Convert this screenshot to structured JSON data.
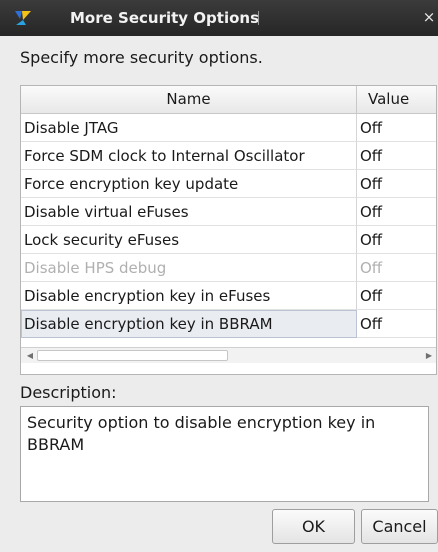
{
  "window": {
    "title": "More Security Options",
    "close_glyph": "×",
    "icon": "quartus-app-icon"
  },
  "instruction": "Specify more security options.",
  "table": {
    "columns": [
      "Name",
      "Value"
    ],
    "rows": [
      {
        "name": "Disable JTAG",
        "value": "Off",
        "enabled": true,
        "selected": false
      },
      {
        "name": "Force SDM clock to Internal Oscillator",
        "value": "Off",
        "enabled": true,
        "selected": false
      },
      {
        "name": "Force encryption key update",
        "value": "Off",
        "enabled": true,
        "selected": false
      },
      {
        "name": "Disable virtual eFuses",
        "value": "Off",
        "enabled": true,
        "selected": false
      },
      {
        "name": "Lock security eFuses",
        "value": "Off",
        "enabled": true,
        "selected": false
      },
      {
        "name": "Disable HPS debug",
        "value": "Off",
        "enabled": false,
        "selected": false
      },
      {
        "name": "Disable encryption key in eFuses",
        "value": "Off",
        "enabled": true,
        "selected": false
      },
      {
        "name": "Disable encryption key in BBRAM",
        "value": "Off",
        "enabled": true,
        "selected": true
      }
    ],
    "scroll_left_glyph": "◀",
    "scroll_right_glyph": "▶"
  },
  "description": {
    "label": "Description:",
    "text": "Security option to disable encryption key in BBRAM"
  },
  "buttons": {
    "ok": "OK",
    "cancel": "Cancel"
  },
  "colors": {
    "titlebar": "#2e2e2e",
    "selection": "#e9ecf1",
    "disabled_text": "#b0b0b0"
  }
}
